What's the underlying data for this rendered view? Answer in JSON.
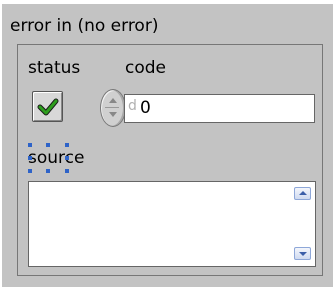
{
  "cluster": {
    "title": "error in (no error)"
  },
  "status": {
    "label": "status",
    "value": true,
    "icon": "check-icon",
    "check_color": "#2e9e1e"
  },
  "code": {
    "label": "code",
    "radix": "d",
    "value": "0"
  },
  "source": {
    "label": "source",
    "value": ""
  },
  "colors": {
    "panel": "#c3c3c3",
    "selection": "#2e63c8"
  }
}
